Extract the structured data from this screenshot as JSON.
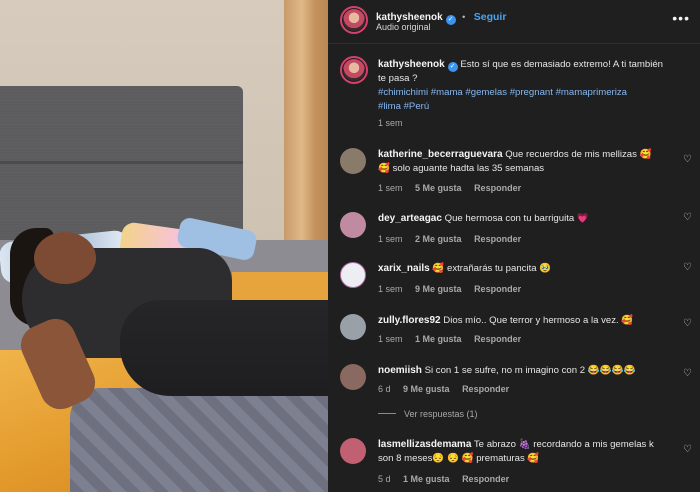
{
  "post": {
    "author": "kathysheenok",
    "follow_label": "Seguir",
    "audio": "Audio original",
    "caption_lines": [
      "Esto sí que es demasiado extremo! A ti también",
      "te pasa ?"
    ],
    "hashtag_lines": [
      "#chimichimi #mama #gemelas #pregnant #mamaprimeriza",
      "#lima #Perú"
    ],
    "age": "1 sem",
    "more_icon": "more-horizontal-icon"
  },
  "colors": {
    "accent": "#4aa3f2",
    "hashtag": "#86b7f0",
    "panel_bg": "#1f1f1f",
    "verified": "#3b95f0"
  },
  "comments": [
    {
      "user": "katherine_becerraguevara",
      "lines": [
        "Que recuerdos de mis mellizas 🥰",
        "🥰 solo aguante hadta las 35 semanas"
      ],
      "age": "1 sem",
      "likes": "5 Me gusta",
      "reply": "Responder",
      "avatar_color": "#8a7a6a"
    },
    {
      "user": "dey_arteagac",
      "lines": [
        "Que hermosa con tu barriguita 💗"
      ],
      "age": "1 sem",
      "likes": "2 Me gusta",
      "reply": "Responder",
      "avatar_color": "#c08aa0"
    },
    {
      "user": "xarix_nails",
      "lines": [
        "🥰 extrañarás tu pancita 🥹"
      ],
      "age": "1 sem",
      "likes": "9 Me gusta",
      "reply": "Responder",
      "avatar_color": "#e8e8f0"
    },
    {
      "user": "zully.flores92",
      "lines": [
        "Dios mío.. Que terror y hermoso a la vez. 🥰"
      ],
      "age": "1 sem",
      "likes": "1 Me gusta",
      "reply": "Responder",
      "avatar_color": "#9aa0a8"
    },
    {
      "user": "noemiish",
      "lines": [
        "Si con 1 se sufre, no m imagino con 2 😂😂😂😂"
      ],
      "age": "6 d",
      "likes": "9 Me gusta",
      "reply": "Responder",
      "avatar_color": "#8a6a60",
      "view_replies": "Ver respuestas (1)"
    },
    {
      "user": "lasmellizasdemama",
      "lines": [
        "Te abrazo 🍇 recordando a mis gemelas k",
        "son 8 meses😔 😔 🥰 prematuras 🥰"
      ],
      "age": "5 d",
      "likes": "1 Me gusta",
      "reply": "Responder",
      "avatar_color": "#c06070"
    }
  ],
  "icons": {
    "heart": "heart-outline-icon",
    "verified": "verified-badge-icon"
  }
}
